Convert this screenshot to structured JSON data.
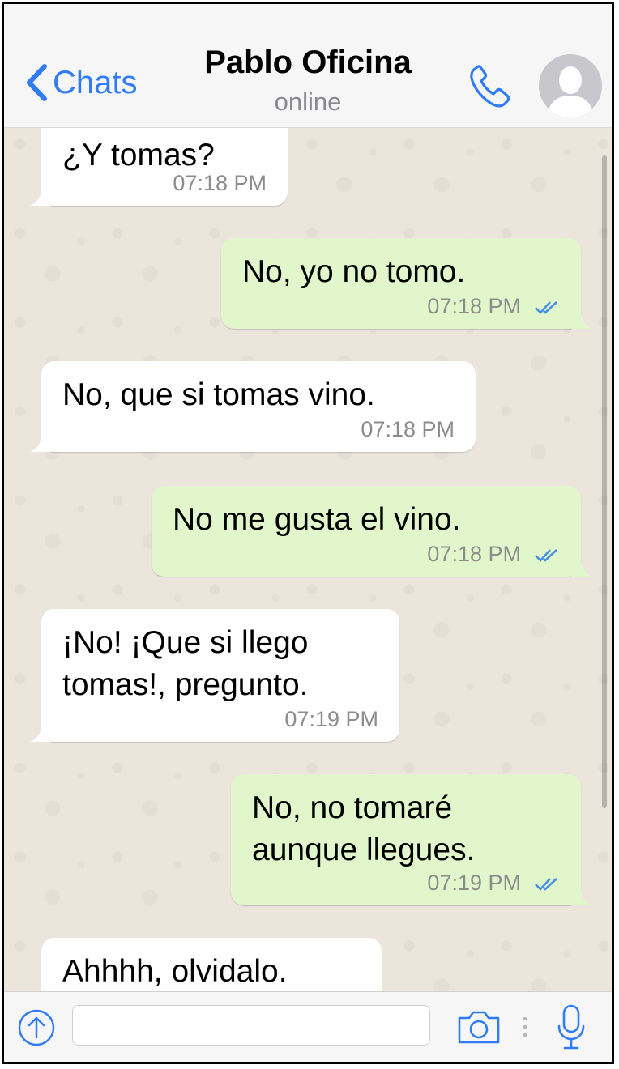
{
  "header": {
    "back_label": "Chats",
    "contact_name": "Pablo Oficina",
    "status": "online"
  },
  "messages": [
    {
      "direction": "incoming",
      "text": "¿Y tomas?",
      "time": "07:18 PM"
    },
    {
      "direction": "outgoing",
      "text": "No, yo no tomo.",
      "time": "07:18 PM",
      "read": true
    },
    {
      "direction": "incoming",
      "text": "No, que si tomas vino.",
      "time": "07:18 PM"
    },
    {
      "direction": "outgoing",
      "text": "No me gusta el vino.",
      "time": "07:18 PM",
      "read": true
    },
    {
      "direction": "incoming",
      "text": "¡No! ¡Que si llego\ntomas!, pregunto.",
      "time": "07:19 PM"
    },
    {
      "direction": "outgoing",
      "text": "No, no tomaré\naunque llegues.",
      "time": "07:19 PM",
      "read": true
    },
    {
      "direction": "incoming",
      "text": "Ahhhh, olvidalo."
    }
  ],
  "input": {
    "placeholder": "",
    "value": ""
  },
  "colors": {
    "accent": "#2f7cf6",
    "incoming_bubble": "#ffffff",
    "outgoing_bubble": "#e1f7cb",
    "read_ticks": "#4a90e2",
    "chat_background": "#ece5dc"
  },
  "icons": {
    "back": "chevron-left-icon",
    "call": "phone-icon",
    "avatar": "user-silhouette-icon",
    "attach": "upload-arrow-icon",
    "camera": "camera-icon",
    "mic": "microphone-icon"
  }
}
